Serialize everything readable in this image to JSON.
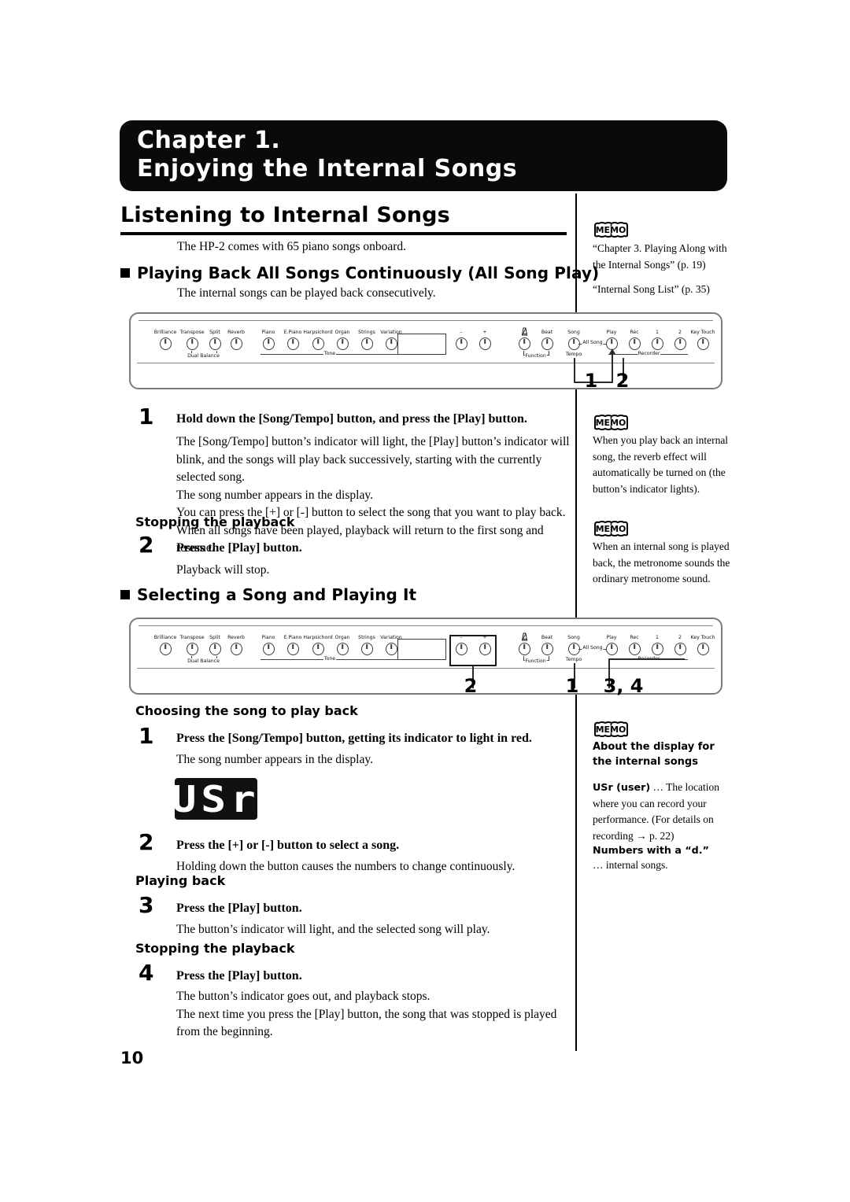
{
  "chapter": {
    "line1": "Chapter 1.",
    "line2": "Enjoying the Internal Songs"
  },
  "page_number": "10",
  "section1": {
    "heading": "Listening to Internal Songs",
    "intro": "The HP-2 comes with 65 piano songs onboard.",
    "sub_heading": "Playing Back All Songs Continuously (All Song Play)",
    "sub_intro": "The internal songs can be played back consecutively.",
    "steps": [
      {
        "num": "1",
        "title": "Hold down the [Song/Tempo] button, and press the [Play] button.",
        "body": "The [Song/Tempo] button’s indicator will light, the [Play] button’s indicator will blink, and the songs will play back successively, starting with the currently selected song.\nThe song number appears in the display.\nYou can press the [+] or [-] button to select the song that you want to play back.\nWhen all songs have been played, playback will return to the first song and resume."
      }
    ],
    "stopping_heading": "Stopping the playback",
    "step2": {
      "num": "2",
      "title": "Press the [Play] button.",
      "body": "Playback will stop."
    }
  },
  "section2": {
    "sub_heading": "Selecting a Song and Playing It",
    "choosing_heading": "Choosing the song to play back",
    "step1": {
      "num": "1",
      "title": "Press the [Song/Tempo] button, getting its indicator to light in red.",
      "body": "The song number appears in the display."
    },
    "display_value": "USr",
    "step2": {
      "num": "2",
      "title": "Press the [+] or [-] button to select a song.",
      "body": "Holding down the button causes the numbers to change continuously."
    },
    "playing_back_heading": "Playing back",
    "step3": {
      "num": "3",
      "title": "Press the [Play] button.",
      "body": "The button’s indicator will light, and the selected song will play."
    },
    "stopping_heading": "Stopping the playback",
    "step4": {
      "num": "4",
      "title": "Press the [Play] button.",
      "body": "The button’s indicator goes out, and playback stops.\nThe next time you press the [Play] button, the song that was stopped is played from the beginning."
    }
  },
  "memos": [
    {
      "icon": "memo-icon",
      "lines": "“Chapter 3. Playing Along with the Internal Songs” (p. 19)",
      "lines2": "“Internal Song List” (p. 35)"
    },
    {
      "icon": "memo-icon",
      "lines": "When you play back an internal song, the reverb effect will automatically be turned on (the button’s indicator lights)."
    },
    {
      "icon": "memo-icon",
      "lines": "When an internal song is played back, the metronome sounds the ordinary metronome sound."
    },
    {
      "icon": "memo-icon",
      "head": "About the display for the internal songs",
      "usr_bold": "USr (user)",
      "usr_rest": " … The location where you can record your performance. (For details on recording → p. 22)",
      "num_bold": "Numbers with a “d.”",
      "num_rest": "… internal songs."
    }
  ],
  "panel": {
    "left_knobs": [
      {
        "label": "Brilliance"
      },
      {
        "label": "Transpose"
      },
      {
        "label": "Split"
      },
      {
        "label": "Reverb"
      }
    ],
    "dual_balance_label": "Dual Balance",
    "tone_knobs": [
      {
        "label": "Piano"
      },
      {
        "label": "E.Piano"
      },
      {
        "label": "Harpsichord"
      },
      {
        "label": "Organ"
      },
      {
        "label": "Strings"
      },
      {
        "label": "Variation"
      }
    ],
    "tone_label": "Tone",
    "plusminus": [
      {
        "label": "–"
      },
      {
        "label": "+"
      }
    ],
    "function_knobs": [
      {
        "label": ""
      },
      {
        "label": "Beat"
      }
    ],
    "function_label": "Function",
    "song_label": "Song",
    "tempo_label": "Tempo",
    "allsong_label": "All Song",
    "recorder_knobs": [
      {
        "label": "Play"
      },
      {
        "label": "Rec"
      },
      {
        "label": "1"
      },
      {
        "label": "2"
      }
    ],
    "recorder_label": "Recorder",
    "keytouch_label": "Key Touch",
    "callouts_panel1": [
      "1",
      "2"
    ],
    "callouts_panel2": [
      "2",
      "1",
      "3, 4"
    ]
  }
}
